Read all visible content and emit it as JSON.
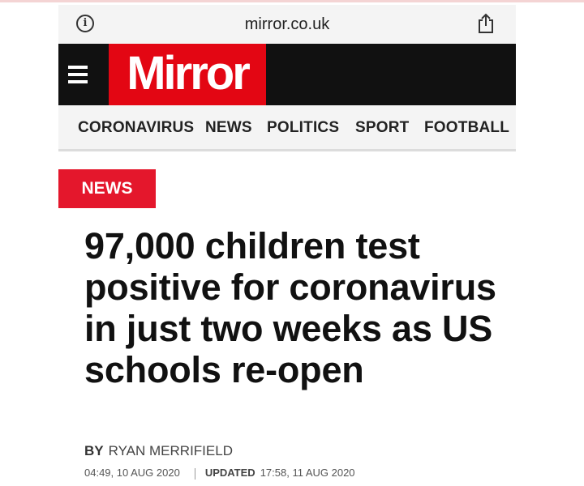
{
  "browser": {
    "url": "mirror.co.uk",
    "icons": {
      "info": "info-icon",
      "share": "share-icon"
    }
  },
  "masthead": {
    "logo": "Mirror",
    "icons": {
      "menu": "hamburger-menu-icon"
    },
    "colors": {
      "background": "#111111",
      "logo_red": "#e30613"
    }
  },
  "nav": {
    "items": [
      {
        "label": "CORONAVIRUS"
      },
      {
        "label": "NEWS"
      },
      {
        "label": "POLITICS"
      },
      {
        "label": "SPORT"
      },
      {
        "label": "FOOTBALL"
      }
    ]
  },
  "article": {
    "tag": "NEWS",
    "headline": "97,000 children test positive for coronavirus in just two weeks as US schools re-open",
    "byline_label": "BY",
    "author": "RYAN MERRIFIELD",
    "published": "04:49, 10 AUG 2020",
    "updated_label": "UPDATED",
    "updated": "17:58, 11 AUG 2020",
    "colors": {
      "tag": "#e4172c"
    }
  }
}
